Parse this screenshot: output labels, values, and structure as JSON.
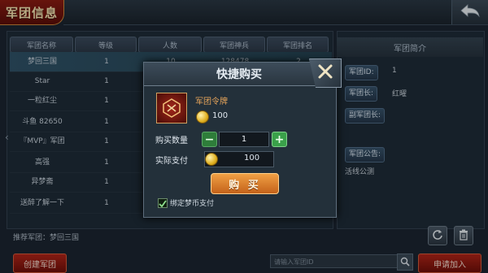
{
  "window": {
    "title": "军团信息"
  },
  "table": {
    "headers": [
      "军团名称",
      "等级",
      "人数",
      "军团神兵",
      "军团排名"
    ],
    "rows": [
      {
        "name": "梦回三国",
        "level": "1",
        "members": "10",
        "weapon": "128478",
        "rank": "2"
      },
      {
        "name": "Star",
        "level": "1",
        "members": "",
        "weapon": "",
        "rank": ""
      },
      {
        "name": "一粒红尘",
        "level": "1",
        "members": "",
        "weapon": "",
        "rank": ""
      },
      {
        "name": "斗鱼 82650",
        "level": "1",
        "members": "",
        "weapon": "",
        "rank": ""
      },
      {
        "name": "『MVP』军团",
        "level": "1",
        "members": "",
        "weapon": "",
        "rank": ""
      },
      {
        "name": "高强",
        "level": "1",
        "members": "",
        "weapon": "",
        "rank": ""
      },
      {
        "name": "异梦斋",
        "level": "1",
        "members": "",
        "weapon": "",
        "rank": ""
      },
      {
        "name": "送醉了解一下",
        "level": "1",
        "members": "",
        "weapon": "",
        "rank": ""
      }
    ]
  },
  "side": {
    "title": "军团简介",
    "id_label": "军团ID:",
    "id_value": "1",
    "leader_label": "军团长:",
    "leader_value": "红曜",
    "vice_label": "副军团长:",
    "notice_label": "军团公告:",
    "notice_value": "活线公测"
  },
  "footer": {
    "recommend": "推荐军团：梦回三国",
    "create_button": "创建军团",
    "search_placeholder": "请输入军团ID",
    "apply_button": "申请加入"
  },
  "dialog": {
    "title": "快捷购买",
    "item_name": "军团令牌",
    "unit_price": "100",
    "qty_label": "购买数量",
    "qty_value": "1",
    "pay_label": "实际支付",
    "pay_value": "100",
    "buy_button": "购 买",
    "checkbox_label": "绑定梦币支付",
    "checkbox_checked": true
  },
  "colors": {
    "accent_red": "#8a1c12",
    "buy_orange": "#e08a30",
    "minus_green": "#2e7d3a",
    "plus_green": "#3aa04a"
  }
}
